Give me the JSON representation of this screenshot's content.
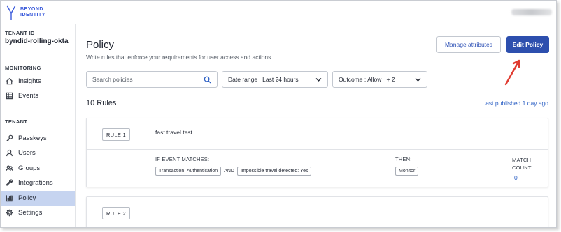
{
  "brand": {
    "logo_line1": "BEYOND",
    "logo_line2": "IDENTITY"
  },
  "sidebar": {
    "tenant_id_label": "TENANT ID",
    "tenant_id_value": "byndid-rolling-okta",
    "monitoring_label": "MONITORING",
    "monitoring_items": [
      {
        "label": "Insights",
        "icon": "home-icon"
      },
      {
        "label": "Events",
        "icon": "table-icon"
      }
    ],
    "tenant_label": "TENANT",
    "tenant_items": [
      {
        "label": "Passkeys",
        "icon": "key-icon"
      },
      {
        "label": "Users",
        "icon": "user-icon"
      },
      {
        "label": "Groups",
        "icon": "groups-icon"
      },
      {
        "label": "Integrations",
        "icon": "wrench-icon"
      },
      {
        "label": "Policy",
        "icon": "policy-icon",
        "active": true
      },
      {
        "label": "Settings",
        "icon": "gear-icon"
      }
    ]
  },
  "main": {
    "title": "Policy",
    "subtitle": "Write rules that enforce your requirements for user access and actions.",
    "manage_button": "Manage attributes",
    "edit_button": "Edit Policy",
    "search_placeholder": "Search policies",
    "date_range": "Date range : Last 24 hours",
    "outcome": "Outcome : Allow   + 2",
    "rules_count": "10 Rules",
    "last_published": "Last published 1 day ago",
    "rules": [
      {
        "tag": "RULE 1",
        "name": "fast travel test",
        "if_label": "IF EVENT MATCHES:",
        "conditions": [
          "Transaction: Authentication",
          "Impossible travel detected: Yes"
        ],
        "and": "AND",
        "then_label": "THEN:",
        "then_value": "Monitor",
        "match_label": "MATCH COUNT:",
        "match_count": "0"
      },
      {
        "tag": "RULE 2"
      }
    ]
  },
  "colors": {
    "accent": "#2d4fae",
    "link": "#2b5fc4",
    "active_nav": "#c6d4f0",
    "annotation_arrow": "#e03a2f"
  }
}
